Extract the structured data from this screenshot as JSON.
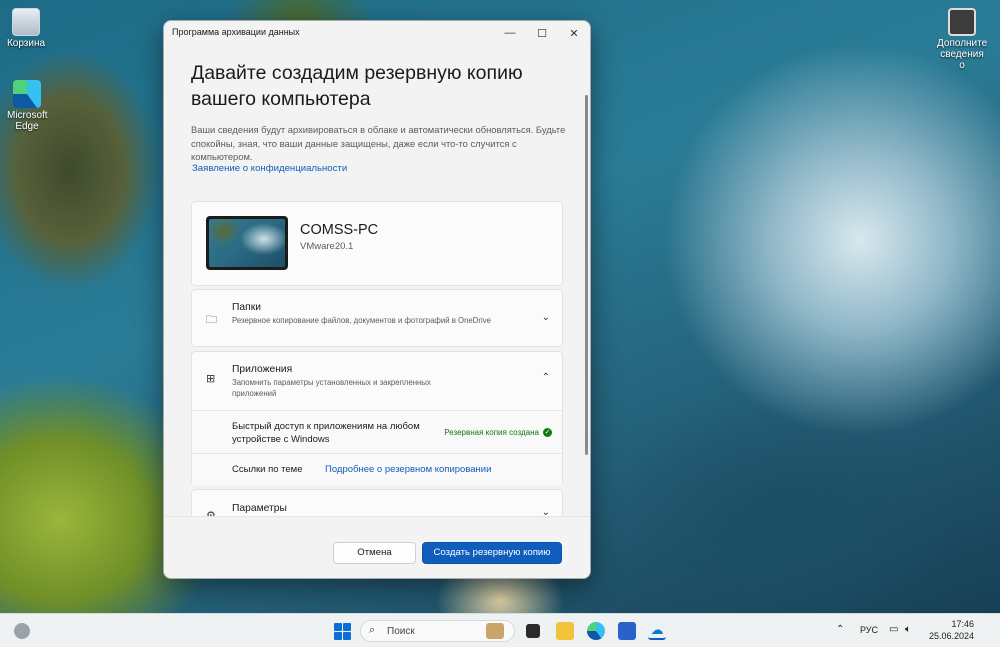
{
  "desktop": {
    "icons": [
      {
        "label": "Корзина",
        "icon": "recycle-bin-icon"
      },
      {
        "label": "Microsoft Edge",
        "icon": "edge-icon"
      },
      {
        "label": "Дополните сведения о",
        "icon": "info-icon"
      }
    ]
  },
  "window": {
    "title": "Программа архивации данных",
    "heading": "Давайте создадим резервную копию вашего компьютера",
    "description": "Ваши сведения будут архивироваться в облаке и автоматически обновляться. Будьте спокойны, зная, что ваши данные защищены, даже если что-то случится с компьютером.",
    "privacy_link": "Заявление о конфиденциальности",
    "pc": {
      "name": "COMSS-PC",
      "model": "VMware20.1"
    },
    "sections": {
      "folders": {
        "title": "Папки",
        "subtitle": "Резервное копирование файлов, документов и фотографий в OneDrive",
        "expanded": false
      },
      "apps": {
        "title": "Приложения",
        "subtitle": "Запомнить параметры установленных и закрепленных приложений",
        "expanded": true,
        "quick_access": "Быстрый доступ к приложениям на любом устройстве с Windows",
        "status": "Резервная копия создана",
        "links_label": "Ссылки по теме",
        "links_link": "Подробнее о резервном копировании"
      },
      "params": {
        "title": "Параметры",
        "expanded": false
      }
    },
    "buttons": {
      "cancel": "Отмена",
      "primary": "Создать резервную копию"
    }
  },
  "taskbar": {
    "search_placeholder": "Поиск",
    "language": "РУС",
    "time": "17:46",
    "date": "25.06.2024"
  },
  "colors": {
    "accent": "#0f5ebd",
    "success": "#0f7b0f"
  }
}
